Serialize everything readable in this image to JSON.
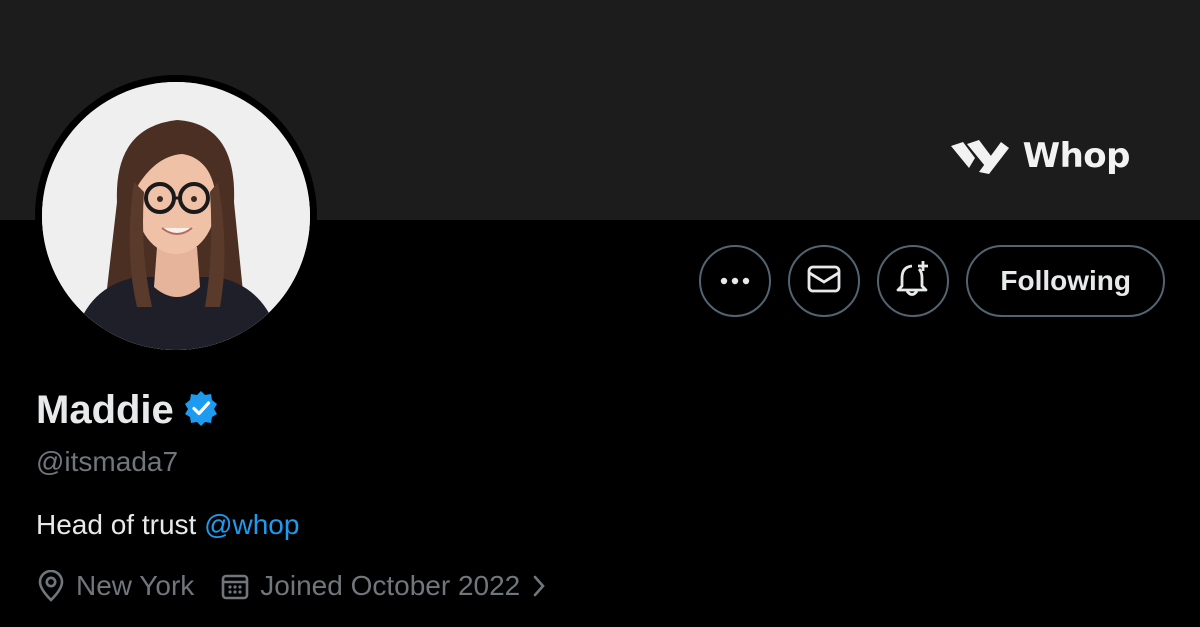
{
  "banner": {
    "brand_name": "Whop",
    "brand_icon": "whop-logo-icon"
  },
  "profile": {
    "display_name": "Maddie",
    "verified_icon": "verified-badge-icon",
    "handle": "@itsmada7",
    "bio": {
      "text": "Head of trust ",
      "mention": "@whop"
    },
    "location": "New York",
    "joined": "Joined October 2022"
  },
  "actions": {
    "more_icon": "more-icon",
    "message_icon": "mail-icon",
    "notify_icon": "bell-plus-icon",
    "follow_label": "Following"
  },
  "colors": {
    "background": "#000000",
    "banner": "#1c1c1c",
    "accent": "#1d9bf0",
    "text_primary": "#e7e9ea",
    "text_secondary": "#71767b",
    "border": "#536471"
  }
}
